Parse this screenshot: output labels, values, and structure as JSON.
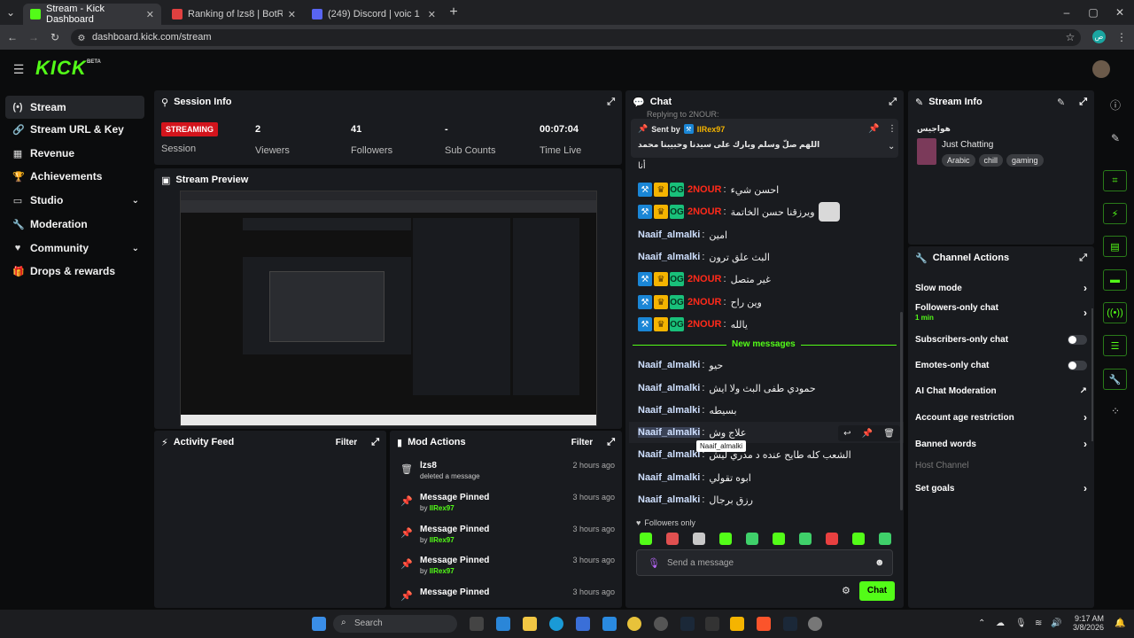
{
  "browser": {
    "tabs": [
      {
        "label": "Stream - Kick Dashboard",
        "active": true,
        "color": "#53fc18"
      },
      {
        "label": "Ranking of lzs8 | BotRix — Clo",
        "active": false,
        "color": "#e04040"
      },
      {
        "label": "(249) Discord | voic 1 | shadow",
        "active": false,
        "color": "#5865f2"
      }
    ],
    "url": "dashboard.kick.com/stream",
    "profile": "ص"
  },
  "app": {
    "logo": "KICK",
    "beta": "BETA",
    "brand_color": "#53fc18"
  },
  "sidebar": {
    "items": [
      {
        "label": "Stream",
        "icon": "broadcast-icon",
        "active": true
      },
      {
        "label": "Stream URL & Key",
        "icon": "link-icon"
      },
      {
        "label": "Revenue",
        "icon": "revenue-icon"
      },
      {
        "label": "Achievements",
        "icon": "trophy-icon"
      },
      {
        "label": "Studio",
        "icon": "monitor-icon",
        "expand": true
      },
      {
        "label": "Moderation",
        "icon": "wrench-icon"
      },
      {
        "label": "Community",
        "icon": "community-icon",
        "expand": true
      },
      {
        "label": "Drops & rewards",
        "icon": "gift-icon"
      }
    ]
  },
  "session": {
    "title": "Session Info",
    "status_badge": "STREAMING",
    "status_label": "Session",
    "viewers": "2",
    "viewers_label": "Viewers",
    "followers": "41",
    "followers_label": "Followers",
    "subs": "-",
    "subs_label": "Sub Counts",
    "time": "00:07:04",
    "time_label": "Time Live"
  },
  "preview": {
    "title": "Stream Preview"
  },
  "activity": {
    "title": "Activity Feed",
    "filter": "Filter"
  },
  "mod_actions": {
    "title": "Mod Actions",
    "filter": "Filter",
    "items": [
      {
        "title": "lzs8",
        "sub": "deleted a message",
        "time": "2 hours ago",
        "icon": "trash-icon"
      },
      {
        "title": "Message Pinned",
        "by": "by",
        "user": "IlRex97",
        "time": "3 hours ago",
        "icon": "pin-icon"
      },
      {
        "title": "Message Pinned",
        "by": "by",
        "user": "IlRex97",
        "time": "3 hours ago",
        "icon": "pin-icon"
      },
      {
        "title": "Message Pinned",
        "by": "by",
        "user": "IlRex97",
        "time": "3 hours ago",
        "icon": "pin-icon"
      },
      {
        "title": "Message Pinned",
        "by": "",
        "user": "",
        "time": "3 hours ago",
        "icon": "pin-icon"
      }
    ]
  },
  "chat": {
    "title": "Chat",
    "replying": "Replying to 2NOUR:",
    "pinned_by": "Sent by",
    "pinned_user": "IlRex97",
    "pinned_text": "اللهم صلّ وسلم وبارك على سيدنا وحبيبنا محمد",
    "top_fragment": "أنا",
    "messages": [
      {
        "user": "2NOUR",
        "text": "احسن شيء",
        "badges": true
      },
      {
        "user": "2NOUR",
        "text": "ويرزقنا حسن الخاتمة",
        "badges": true
      },
      {
        "user": "Naaif_almalki",
        "text": "امين"
      },
      {
        "user": "Naaif_almalki",
        "text": "البث علق ترون"
      },
      {
        "user": "2NOUR",
        "text": "غير متصل",
        "badges": true
      },
      {
        "user": "2NOUR",
        "text": "وين راح",
        "badges": true
      },
      {
        "user": "2NOUR",
        "text": "يالله",
        "badges": true
      }
    ],
    "new_messages": "New messages",
    "messages_after": [
      {
        "user": "Naaif_almalki",
        "text": "حيو"
      },
      {
        "user": "Naaif_almalki",
        "text": "حمودي طفى البث ولا ايش"
      },
      {
        "user": "Naaif_almalki",
        "text": "بسيطه"
      },
      {
        "user": "Naaif_almalki",
        "text": "علاج وش"
      },
      {
        "user": "Naaif_almalki",
        "text": "الشعب كله طايح عنده د مدري ليش"
      },
      {
        "user": "Naaif_almalki",
        "text": "ابوه تقولي"
      },
      {
        "user": "Naaif_almalki",
        "text": "رزق برجال"
      }
    ],
    "tooltip": "Naaif_almalki",
    "followers_only": "Followers only",
    "placeholder": "Send a message",
    "send": "Chat"
  },
  "stream_info": {
    "title": "Stream Info",
    "stream_title": "هواجيس",
    "category": "Just Chatting",
    "tags": [
      "Arabic",
      "chill",
      "gaming"
    ]
  },
  "channel_actions": {
    "title": "Channel Actions",
    "items": [
      {
        "label": "Slow mode",
        "type": "arrow"
      },
      {
        "label": "Followers-only chat",
        "sub": "1 min",
        "type": "arrow"
      },
      {
        "label": "Subscribers-only chat",
        "type": "toggle"
      },
      {
        "label": "Emotes-only chat",
        "type": "toggle"
      },
      {
        "label": "AI Chat Moderation",
        "type": "external"
      },
      {
        "label": "Account age restriction",
        "type": "arrow"
      },
      {
        "label": "Banned words",
        "type": "arrow"
      },
      {
        "label": "Host Channel",
        "type": "disabled"
      },
      {
        "label": "Set goals",
        "type": "arrow"
      }
    ]
  },
  "taskbar": {
    "search": "Search",
    "time": "9:17 AM",
    "date": "3/8/2026"
  }
}
